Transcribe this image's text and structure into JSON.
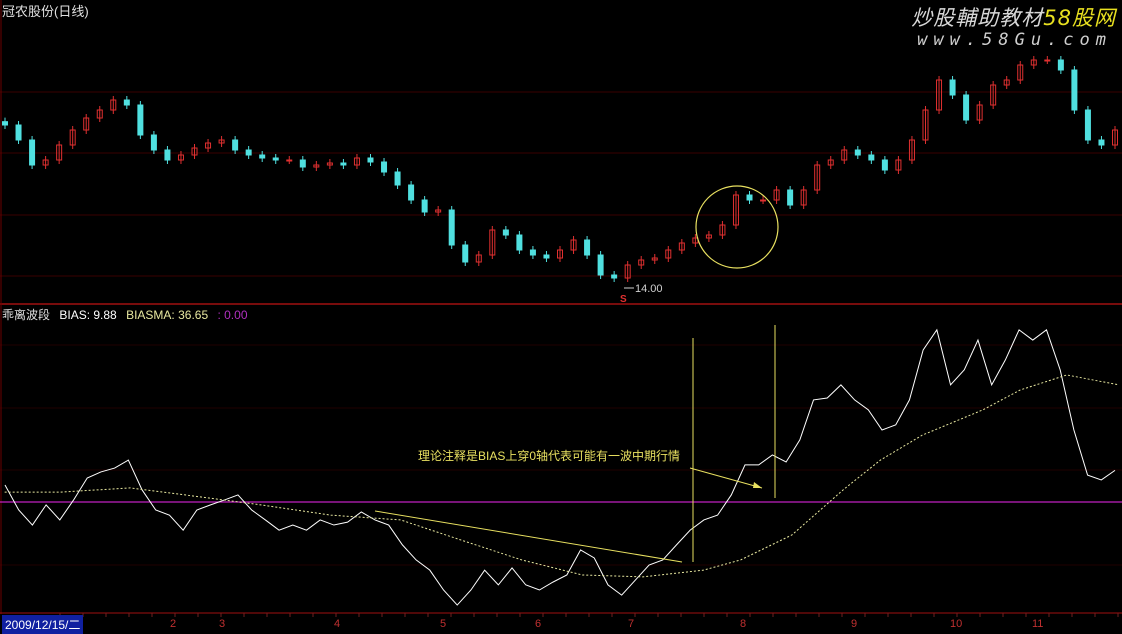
{
  "header": {
    "title": "冠农股份(日线)"
  },
  "watermark": {
    "line1_a": "炒股輔助教材",
    "line1_b": "58股网",
    "line2": "www.58Gu.com"
  },
  "indicator": {
    "name": "乖离波段",
    "bias_label": "BIAS: 9.88",
    "biasma_label": "BIASMA: 36.65",
    "zero_label": ": 0.00"
  },
  "annotation": {
    "text": "理论注释是BIAS上穿0轴代表可能有一波中期行情",
    "low_label": "14.00",
    "signal_mark": "S"
  },
  "xaxis": {
    "date": "2009/12/15/二",
    "months": [
      "2",
      "3",
      "4",
      "5",
      "6",
      "7",
      "8",
      "9",
      "10",
      "11"
    ]
  },
  "colors": {
    "up": "#e03030",
    "down": "#50e0e0",
    "bias": "#ffffff",
    "biasma": "#e8e8a0",
    "zero": "#c020c0",
    "annot": "#e8e060",
    "grid": "#3a0000"
  },
  "chart_data": [
    {
      "type": "candlestick",
      "title": "冠农股份(日线)",
      "closes": [
        18.86,
        18.41,
        17.66,
        17.81,
        18.26,
        18.71,
        19.07,
        19.31,
        19.61,
        19.46,
        18.56,
        18.11,
        17.81,
        17.96,
        18.17,
        18.32,
        18.41,
        18.11,
        17.96,
        17.87,
        17.81,
        17.81,
        17.6,
        17.66,
        17.72,
        17.66,
        17.87,
        17.75,
        17.45,
        17.06,
        16.61,
        16.25,
        16.31,
        15.26,
        14.75,
        14.96,
        15.71,
        15.56,
        15.11,
        14.96,
        14.87,
        15.11,
        15.41,
        14.96,
        14.36,
        14.27,
        14.66,
        14.81,
        14.87,
        15.11,
        15.32,
        15.47,
        15.56,
        15.86,
        16.76,
        16.61,
        16.61,
        16.91,
        16.46,
        16.91,
        17.66,
        17.81,
        18.11,
        17.96,
        17.81,
        17.51,
        17.81,
        18.41,
        19.31,
        20.21,
        19.76,
        19.01,
        19.46,
        20.06,
        20.21,
        20.66,
        20.81,
        20.81,
        20.51,
        19.31,
        18.41,
        18.26,
        18.71
      ],
      "low_marker": 14.0,
      "ylim": [
        13.6,
        21.2
      ]
    },
    {
      "type": "line",
      "title": "乖离波段",
      "series": [
        {
          "name": "BIAS",
          "values": [
            5.3,
            -2.5,
            -7.2,
            -0.9,
            -5.6,
            0.6,
            7.5,
            9.4,
            10.6,
            13.1,
            3.8,
            -2.5,
            -4.1,
            -8.8,
            -2.5,
            -0.9,
            0.6,
            2.2,
            -2.5,
            -5.6,
            -8.8,
            -7.2,
            -8.8,
            -5.6,
            -7.2,
            -6.3,
            -3.1,
            -5.6,
            -7.2,
            -13.4,
            -18.1,
            -21.3,
            -27.5,
            -32.2,
            -27.5,
            -21.3,
            -25.9,
            -20.6,
            -25.9,
            -27.5,
            -25.0,
            -22.8,
            -15.0,
            -17.5,
            -25.9,
            -29.1,
            -24.4,
            -19.7,
            -18.1,
            -13.4,
            -8.8,
            -5.6,
            -4.1,
            2.2,
            11.6,
            11.6,
            14.7,
            12.5,
            19.4,
            31.9,
            32.5,
            36.6,
            31.9,
            28.8,
            22.5,
            24.1,
            31.9,
            47.5,
            53.8,
            36.6,
            41.3,
            50.6,
            36.6,
            44.4,
            53.8,
            50.6,
            53.8,
            41.3,
            22.5,
            8.4,
            6.9,
            9.88
          ]
        },
        {
          "name": "BIASMA",
          "days": [
            1,
            13,
            28,
            43,
            56,
            71,
            86,
            99,
            112,
            125,
            138,
            151,
            159,
            170,
            181,
            189,
            198,
            211,
            219,
            229,
            240
          ],
          "values": [
            3.1,
            3.1,
            4.4,
            1.6,
            -0.9,
            -4.1,
            -5.6,
            -11.9,
            -18.1,
            -22.8,
            -23.4,
            -21.3,
            -18.1,
            -10.3,
            3.8,
            13.1,
            20.9,
            28.8,
            35.0,
            39.7,
            36.65
          ]
        }
      ],
      "total_days": 240,
      "zero_line": 0,
      "ylim": [
        -34,
        55
      ]
    }
  ]
}
